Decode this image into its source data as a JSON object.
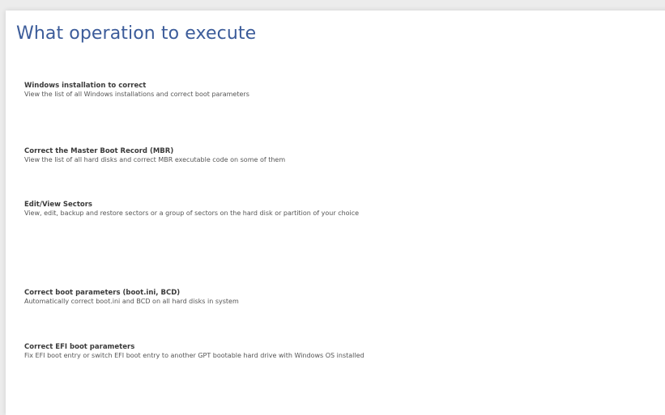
{
  "page": {
    "title": "What operation to execute"
  },
  "operations": [
    {
      "title": "Windows installation to correct",
      "description": "View the list of all Windows installations and correct boot parameters"
    },
    {
      "title": "Correct the Master Boot Record (MBR)",
      "description": "View the list of all hard disks and correct MBR executable code on some of them"
    },
    {
      "title": "Edit/View Sectors",
      "description": "View, edit, backup and restore sectors or a group of sectors on the hard disk or partition of your choice"
    },
    {
      "title": "Correct boot parameters (boot.ini, BCD)",
      "description": "Automatically correct boot.ini and BCD on all hard disks in system"
    },
    {
      "title": "Correct EFI boot parameters",
      "description": "Fix EFI boot entry or switch EFI boot entry to another GPT bootable hard drive with Windows OS installed"
    }
  ],
  "colors": {
    "title": "#3c5c9a",
    "panel_background": "#ffffff",
    "window_background": "#ececec"
  }
}
